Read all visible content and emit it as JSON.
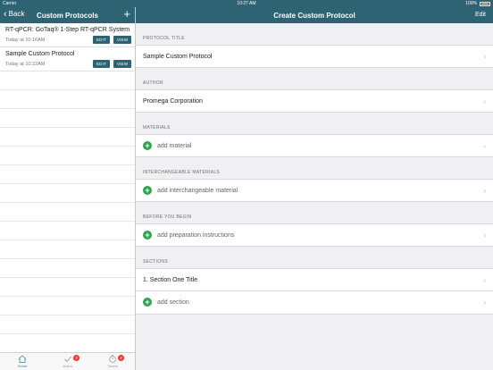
{
  "status_bar": {
    "carrier": "Carrier",
    "time": "10:27 AM",
    "battery": "100%"
  },
  "sidebar_nav": {
    "back_label": "Back",
    "title": "Custom Protocols",
    "add_symbol": "+"
  },
  "detail_nav": {
    "title": "Create Custom Protocol",
    "edit_label": "Edit"
  },
  "protocols": [
    {
      "title": "RT-qPCR: GoTaq® 1-Step RT-qPCR System",
      "date": "Today at 10:16AM",
      "edit": "EDIT",
      "view": "VIEW"
    },
    {
      "title": "Sample Custom Protocol",
      "date": "Today at 10:22AM",
      "edit": "EDIT",
      "view": "VIEW"
    }
  ],
  "tabs": [
    {
      "label": "Home",
      "icon": "home-icon",
      "active": true,
      "badge": ""
    },
    {
      "label": "Active",
      "icon": "check-icon",
      "active": false,
      "badge": "3"
    },
    {
      "label": "Timers",
      "icon": "timer-icon",
      "active": false,
      "badge": "2"
    }
  ],
  "form": {
    "protocol_title": {
      "header": "PROTOCOL TITLE",
      "value": "Sample Custom Protocol"
    },
    "author": {
      "header": "AUTHOR",
      "value": "Promega Corporation"
    },
    "materials": {
      "header": "MATERIALS",
      "add_label": "add material"
    },
    "interchangeable": {
      "header": "INTERCHANGEABLE MATERIALS",
      "add_label": "add interchangeable material"
    },
    "before_you_begin": {
      "header": "BEFORE YOU BEGIN",
      "add_label": "add preparation instructions"
    },
    "sections": {
      "header": "SECTIONS",
      "item": "1. Section One Title",
      "add_label": "add section"
    }
  },
  "colors": {
    "nav_bg": "#2e6374",
    "accent_green": "#2ea44f",
    "badge_red": "#e53935",
    "tab_active": "#2f80b0"
  }
}
